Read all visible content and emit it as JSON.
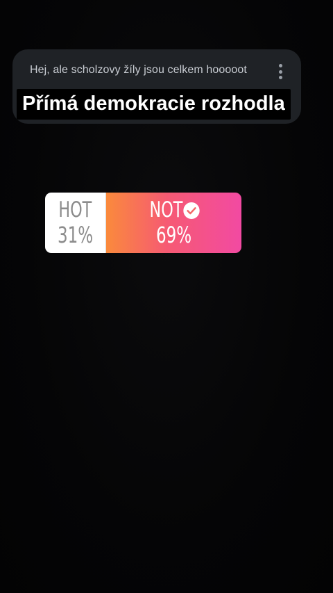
{
  "question": {
    "text": "Hej, ale scholzovy žíly jsou celkem hooooot",
    "menu_icon": "more-vertical-icon"
  },
  "caption": {
    "text": "Přímá demokracie rozhodla"
  },
  "poll": {
    "options": [
      {
        "label": "HOT",
        "percent": "31%",
        "value": 31,
        "selected": false
      },
      {
        "label": "NOT",
        "percent": "69%",
        "value": 69,
        "selected": true,
        "icon": "check-circle-icon"
      }
    ],
    "colors": {
      "hot_bg": "#ffffff",
      "hot_text": "#8c8c8c",
      "not_gradient_start": "#fa8a3c",
      "not_gradient_end": "#f24aa2",
      "not_text": "#ffffff"
    }
  }
}
